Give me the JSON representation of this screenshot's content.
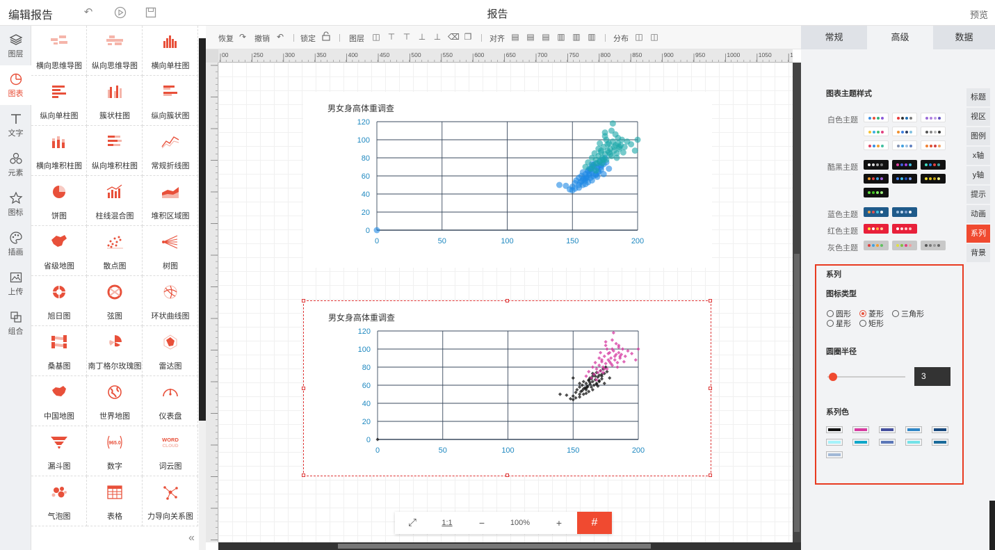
{
  "app": {
    "title": "编辑报告",
    "center_title": "报告",
    "preview": "预览"
  },
  "left_nav": [
    {
      "id": "layers",
      "label": "图层",
      "icon": "layers-icon"
    },
    {
      "id": "chart",
      "label": "图表",
      "icon": "chart-icon",
      "active": true
    },
    {
      "id": "text",
      "label": "文字",
      "icon": "text-icon"
    },
    {
      "id": "element",
      "label": "元素",
      "icon": "element-icon"
    },
    {
      "id": "icon",
      "label": "图标",
      "icon": "star-icon"
    },
    {
      "id": "illustration",
      "label": "插画",
      "icon": "palette-icon"
    },
    {
      "id": "upload",
      "label": "上传",
      "icon": "upload-image-icon"
    },
    {
      "id": "group",
      "label": "组合",
      "icon": "group-icon"
    }
  ],
  "chart_types": [
    "横向思维导图",
    "纵向思维导图",
    "横向单柱图",
    "纵向单柱图",
    "簇状柱图",
    "纵向簇状图",
    "横向堆积柱图",
    "纵向堆积柱图",
    "常规折线图",
    "饼图",
    "柱线混合图",
    "堆积区域图",
    "省级地图",
    "散点图",
    "树图",
    "旭日图",
    "弦图",
    "环状曲线图",
    "桑基图",
    "南丁格尔玫瑰图",
    "雷达图",
    "中国地图",
    "世界地图",
    "仪表盘",
    "漏斗图",
    "数字",
    "词云图",
    "气泡图",
    "表格",
    "力导向关系图"
  ],
  "chart_icon_labels": {
    "number": "965.0",
    "word": "WORD",
    "cloud": "CLOUD"
  },
  "toolbar": {
    "redo": "恢复",
    "undo": "撤销",
    "lock": "锁定",
    "layer": "图层",
    "align": "对齐",
    "distribute": "分布"
  },
  "ruler": {
    "ticks": [
      "00",
      "250",
      "300",
      "350",
      "400",
      "450",
      "500",
      "550",
      "600",
      "650",
      "700",
      "750",
      "800",
      "850",
      "900",
      "950",
      "1000",
      "1050",
      "1100",
      "1150",
      "1200",
      "1250"
    ]
  },
  "zoom": {
    "fit": "⤢",
    "one_to_one": "1:1",
    "minus": "−",
    "level": "100%",
    "plus": "+",
    "grid": "#"
  },
  "right_panel": {
    "tabs": [
      "常规",
      "高级",
      "数据"
    ],
    "active_tab": "高级",
    "side_tabs": [
      "标题",
      "视区",
      "图例",
      "x轴",
      "y轴",
      "提示",
      "动画",
      "系列",
      "背景"
    ],
    "active_side_tab": "系列",
    "theme_section_title": "图表主题样式",
    "themes": [
      {
        "label": "白色主题",
        "bg": "#ffffff",
        "rows": [
          [
            [
              "#3a8de0",
              "#e8503a",
              "#34b07a",
              "#8a5ad8"
            ],
            [
              "#e83a3a",
              "#333",
              "#1f6fb5",
              "#7a7a7a"
            ],
            [
              "#9a6ad8",
              "#b080e0",
              "#c0a0e8",
              "#6050c0"
            ]
          ],
          [
            [
              "#f5c030",
              "#3ab0e0",
              "#40c070",
              "#e04080"
            ],
            [
              "#f09030",
              "#4080e0",
              "#2a3a60",
              "#80c0e0"
            ],
            [
              "#555555",
              "#888888",
              "#bbbbbb",
              "#333333"
            ]
          ],
          [
            [
              "#e04060",
              "#3a8de0",
              "#f0a030",
              "#40c0a0"
            ],
            [
              "#8090b0",
              "#40a0e0",
              "#a0c0e0",
              "#6080c0"
            ],
            [
              "#f08030",
              "#e05030",
              "#d04040",
              "#f0a060"
            ]
          ]
        ]
      },
      {
        "label": "酷黑主题",
        "bg": "#111111",
        "rows": [
          [
            [
              "#ffffff",
              "#dddddd",
              "#aaaaaa",
              "#777777"
            ],
            [
              "#e040a0",
              "#4060e0",
              "#a040e0",
              "#40c0e0"
            ],
            [
              "#40e0c0",
              "#2080e0",
              "#e04040",
              "#40a0a0"
            ]
          ],
          [
            [
              "#f0a030",
              "#e04040",
              "#40a0e0",
              "#a060e0"
            ],
            [
              "#4080f0",
              "#40c0f0",
              "#2050c0",
              "#80a0f0"
            ],
            [
              "#f0e030",
              "#e0c020",
              "#c0a010",
              "#f0f080"
            ]
          ],
          [
            [
              "#60e040",
              "#40c020",
              "#80f060",
              "#a0f080"
            ]
          ]
        ]
      },
      {
        "label": "蓝色主题",
        "bg": "#1f5a8a",
        "rows": [
          [
            [
              "#f0a040",
              "#e05050",
              "#40c0e0",
              "#ffffff"
            ],
            [
              "#a0c0e0",
              "#c0d8f0",
              "#80a0d0",
              "#ffffff"
            ]
          ]
        ]
      },
      {
        "label": "红色主题",
        "bg": "#e8203a",
        "rows": [
          [
            [
              "#ffe040",
              "#ffffff",
              "#ffb040",
              "#ffd0a0"
            ],
            [
              "#ffffff",
              "#ffe0e0",
              "#ffd0d0",
              "#ffc0c0"
            ]
          ]
        ]
      },
      {
        "label": "灰色主题",
        "bg": "#c8c8c8",
        "rows": [
          [
            [
              "#e04040",
              "#40a0e0",
              "#f0a030",
              "#60c060"
            ],
            [
              "#e0e040",
              "#80c040",
              "#e04080",
              "#f0a0a0"
            ],
            [
              "#555555",
              "#777777",
              "#999999",
              "#666666"
            ]
          ]
        ]
      }
    ],
    "series": {
      "section_title": "系列",
      "icon_type_label": "图标类型",
      "icon_types": [
        "圆形",
        "菱形",
        "三角形",
        "星形",
        "矩形"
      ],
      "selected_icon_type": "菱形",
      "radius_label": "圆圈半径",
      "radius_value": "3",
      "radius_fraction": 0.05,
      "color_label": "系列色",
      "colors": [
        "#111111",
        "#d63aa0",
        "#434e9e",
        "#2f86c6",
        "#16477d",
        "#a6f3fb",
        "#0fa7c9",
        "#5b77b8",
        "#74e2e8",
        "#1a6a9a",
        "#a1b8d6"
      ]
    }
  },
  "chart_data": [
    {
      "type": "scatter",
      "title": "男女身高体重调查",
      "xlabel": "",
      "ylabel": "",
      "xlim": [
        0,
        200
      ],
      "ylim": [
        0,
        120
      ],
      "xticks": [
        0,
        50,
        100,
        150,
        200
      ],
      "yticks": [
        0,
        20,
        40,
        60,
        80,
        100,
        120
      ],
      "grid": true,
      "marker": "circle",
      "series": [
        {
          "color": "#1e88e5",
          "x": [
            0,
            140,
            145,
            148,
            150,
            152,
            153,
            155,
            155,
            156,
            157,
            158,
            158,
            159,
            160,
            160,
            161,
            162,
            162,
            163,
            163,
            164,
            165,
            165,
            166,
            166,
            167,
            168,
            168,
            169,
            170,
            170,
            171,
            172,
            172,
            173,
            174,
            175,
            150,
            152,
            158,
            160,
            163,
            165,
            168,
            170,
            155,
            157,
            161,
            164,
            167,
            169,
            172,
            174,
            176,
            178,
            160,
            162,
            165
          ],
          "y": [
            0,
            50,
            49,
            45,
            48,
            52,
            55,
            47,
            58,
            53,
            60,
            50,
            64,
            57,
            55,
            62,
            59,
            66,
            53,
            61,
            68,
            58,
            64,
            70,
            60,
            72,
            66,
            62,
            74,
            69,
            65,
            71,
            76,
            70,
            67,
            78,
            73,
            80,
            44,
            46,
            56,
            51,
            63,
            55,
            61,
            64,
            50,
            54,
            58,
            67,
            70,
            59,
            72,
            62,
            75,
            68,
            57,
            65,
            73
          ]
        },
        {
          "color": "#1ba6a8",
          "x": [
            160,
            162,
            164,
            165,
            166,
            167,
            168,
            169,
            170,
            171,
            172,
            173,
            174,
            175,
            176,
            177,
            178,
            179,
            180,
            181,
            182,
            183,
            184,
            185,
            186,
            188,
            190,
            192,
            195,
            198,
            200,
            170,
            172,
            175,
            178,
            180,
            182,
            185,
            168,
            174,
            176,
            179,
            183,
            187,
            173,
            177,
            181,
            184,
            186,
            189,
            171,
            175
          ],
          "y": [
            70,
            75,
            68,
            80,
            72,
            85,
            78,
            74,
            82,
            76,
            88,
            80,
            92,
            84,
            78,
            95,
            86,
            90,
            82,
            98,
            88,
            94,
            85,
            96,
            90,
            100,
            92,
            98,
            95,
            88,
            100,
            90,
            86,
            104,
            96,
            110,
            92,
            102,
            66,
            78,
            100,
            84,
            106,
            94,
            74,
            88,
            118,
            80,
            92,
            86,
            96,
            108
          ]
        }
      ]
    },
    {
      "type": "scatter",
      "title": "男女身高体重调查",
      "xlabel": "",
      "ylabel": "",
      "xlim": [
        0,
        200
      ],
      "ylim": [
        0,
        120
      ],
      "xticks": [
        0,
        50,
        100,
        150,
        200
      ],
      "yticks": [
        0,
        20,
        40,
        60,
        80,
        100,
        120
      ],
      "grid": true,
      "marker": "diamond",
      "series": [
        {
          "color": "#111111",
          "x": [
            0,
            140,
            145,
            148,
            150,
            152,
            153,
            155,
            155,
            156,
            157,
            158,
            158,
            159,
            160,
            160,
            161,
            162,
            162,
            163,
            163,
            164,
            165,
            165,
            166,
            166,
            167,
            168,
            168,
            169,
            170,
            170,
            171,
            172,
            172,
            173,
            174,
            175,
            150,
            152,
            158,
            160,
            163,
            165,
            168,
            170,
            155,
            157,
            161,
            164,
            167,
            169,
            172,
            174,
            176,
            178,
            160,
            162,
            165,
            150,
            155
          ],
          "y": [
            0,
            50,
            49,
            45,
            48,
            52,
            55,
            47,
            58,
            53,
            60,
            50,
            64,
            57,
            55,
            62,
            59,
            66,
            53,
            61,
            68,
            58,
            64,
            70,
            60,
            72,
            66,
            62,
            74,
            69,
            65,
            71,
            76,
            70,
            67,
            78,
            73,
            80,
            44,
            46,
            56,
            51,
            63,
            55,
            61,
            64,
            50,
            54,
            58,
            67,
            70,
            59,
            72,
            62,
            75,
            68,
            57,
            65,
            73,
            68,
            62
          ]
        },
        {
          "color": "#d63aa0",
          "x": [
            160,
            162,
            164,
            165,
            166,
            167,
            168,
            169,
            170,
            171,
            172,
            173,
            174,
            175,
            176,
            177,
            178,
            179,
            180,
            181,
            182,
            183,
            184,
            185,
            186,
            188,
            190,
            192,
            195,
            198,
            200,
            170,
            172,
            175,
            178,
            180,
            182,
            185,
            168,
            174,
            176,
            179,
            183,
            187,
            173,
            177,
            181,
            184,
            186,
            189,
            171,
            175,
            180,
            185
          ],
          "y": [
            70,
            75,
            68,
            80,
            72,
            85,
            78,
            74,
            82,
            76,
            88,
            80,
            92,
            84,
            78,
            95,
            86,
            90,
            82,
            98,
            88,
            94,
            85,
            96,
            90,
            100,
            92,
            98,
            95,
            88,
            100,
            90,
            86,
            104,
            96,
            110,
            92,
            102,
            66,
            78,
            100,
            84,
            106,
            94,
            74,
            88,
            118,
            80,
            92,
            86,
            96,
            108,
            100,
            104
          ]
        }
      ]
    }
  ]
}
